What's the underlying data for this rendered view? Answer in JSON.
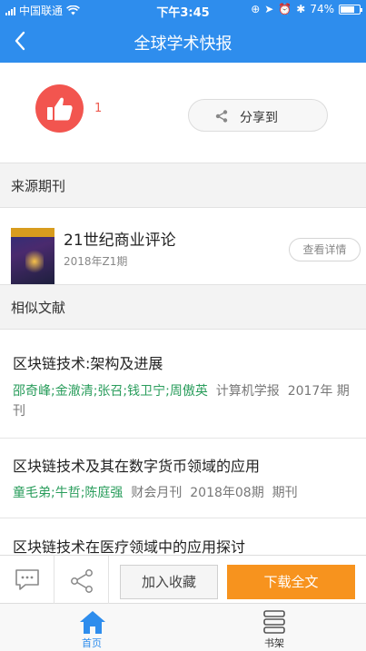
{
  "status_bar": {
    "carrier": "中国联通",
    "time": "下午3:45",
    "battery": "74%",
    "battery_level": 0.74
  },
  "nav": {
    "title": "全球学术快报",
    "back_icon": "chevron-left-icon"
  },
  "like": {
    "count": "1",
    "icon": "thumbs-up-icon"
  },
  "share": {
    "label": "分享到",
    "icon": "share-icon"
  },
  "source_section": {
    "title": "来源期刊"
  },
  "journal": {
    "name": "21世纪商业评论",
    "issue": "2018年Z1期",
    "detail_label": "查看详情"
  },
  "similar_section": {
    "title": "相似文献"
  },
  "articles": [
    {
      "title": "区块链技术:架构及进展",
      "authors": "邵奇峰;金澈清;张召;钱卫宁;周傲英",
      "journal": "计算机学报",
      "year": "2017年",
      "type": "期刊"
    },
    {
      "title": "区块链技术及其在数字货币领域的应用",
      "authors": "童毛弟;牛哲;陈庭强",
      "journal": "财会月刊",
      "year": "2018年08期",
      "type": "期刊"
    },
    {
      "title": "区块链技术在医疗领域中的应用探讨"
    }
  ],
  "actions": {
    "comment_icon": "comment-icon",
    "share_icon": "share-icon",
    "favorite_label": "加入收藏",
    "download_label": "下载全文"
  },
  "tabs": [
    {
      "label": "首页",
      "icon": "home-icon",
      "active": true
    },
    {
      "label": "书架",
      "icon": "bookshelf-icon",
      "active": false
    }
  ],
  "colors": {
    "header_blue": "#2e8ded",
    "like_red": "#f2554f",
    "author_green": "#2a9d5c",
    "download_orange": "#f7931e"
  }
}
